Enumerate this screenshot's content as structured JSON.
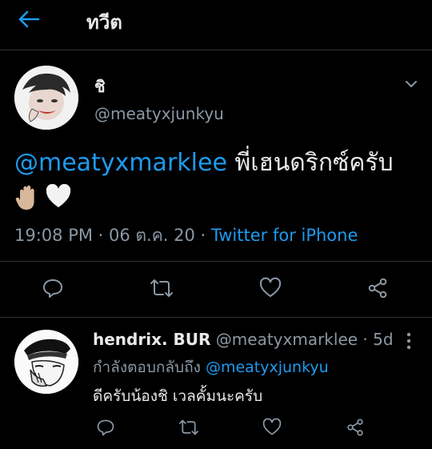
{
  "header": {
    "title": "ทวีต",
    "back_icon": "arrow-left-icon",
    "accent": "#1d9bf0"
  },
  "tweet": {
    "author_name": "ชิ",
    "author_handle": "@meatyxjunkyu",
    "mention": "@meatyxmarklee",
    "text": " พี่เฮนดริกซ์ครับ",
    "emoji": [
      "raised-hand-icon",
      "white-heart-icon"
    ],
    "time": "19:08 PM",
    "date": "06 ต.ค. 20",
    "dot": " · ",
    "source": "Twitter for iPhone"
  },
  "actions": [
    "reply-icon",
    "retweet-icon",
    "like-icon",
    "share-icon"
  ],
  "reply": {
    "author_name": "hendrix. BUR",
    "author_handle": "@meatyxmarklee",
    "dot": " · ",
    "age": "5d",
    "replying_label": "กำลังตอบกลับถึง ",
    "replying_to": "@meatyxjunkyu",
    "text": "ดีครับน้องชิ เวลคั้มนะครับ"
  },
  "colors": {
    "background": "#000000",
    "text": "#e7e9ea",
    "muted": "#8b98a5",
    "link": "#1d9bf0",
    "divider": "#2f3336"
  }
}
